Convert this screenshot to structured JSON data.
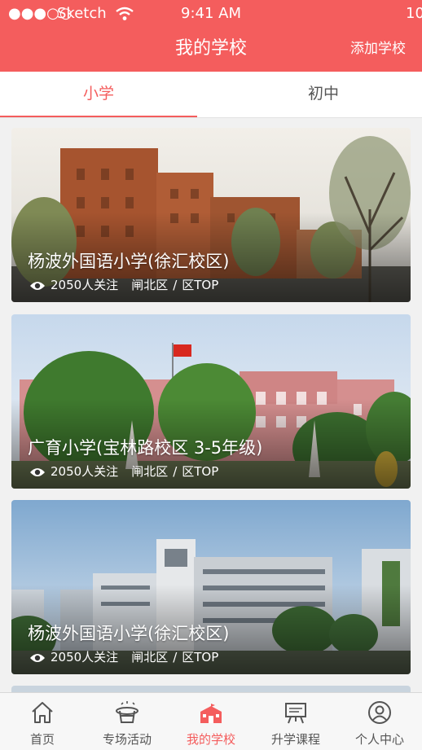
{
  "status_bar": {
    "signal": "●●●○○",
    "carrier": "Sketch",
    "time": "9:41 AM",
    "battery": "10"
  },
  "header": {
    "title": "我的学校",
    "action_label": "添加学校",
    "accent_color": "#f45d5d"
  },
  "tabs": [
    {
      "label": "小学",
      "active": true
    },
    {
      "label": "初中",
      "active": false
    }
  ],
  "schools": [
    {
      "name": "杨波外国语小学(徐汇校区)",
      "followers": "2050人关注",
      "district": "闸北区",
      "separator": "/",
      "rank": "区TOP",
      "image": "brick-school-building"
    },
    {
      "name": "广育小学(宝林路校区 3-5年级)",
      "followers": "2050人关注",
      "district": "闸北区",
      "separator": "/",
      "rank": "区TOP",
      "image": "pink-school-with-flag"
    },
    {
      "name": "杨波外国语小学(徐汇校区)",
      "followers": "2050人关注",
      "district": "闸北区",
      "separator": "/",
      "rank": "区TOP",
      "image": "modern-campus-building"
    }
  ],
  "tabbar": [
    {
      "label": "首页",
      "icon": "home-icon",
      "active": false
    },
    {
      "label": "专场活动",
      "icon": "magic-hat-icon",
      "active": false
    },
    {
      "label": "我的学校",
      "icon": "school-icon",
      "active": true
    },
    {
      "label": "升学课程",
      "icon": "easel-icon",
      "active": false
    },
    {
      "label": "个人中心",
      "icon": "user-icon",
      "active": false
    }
  ]
}
